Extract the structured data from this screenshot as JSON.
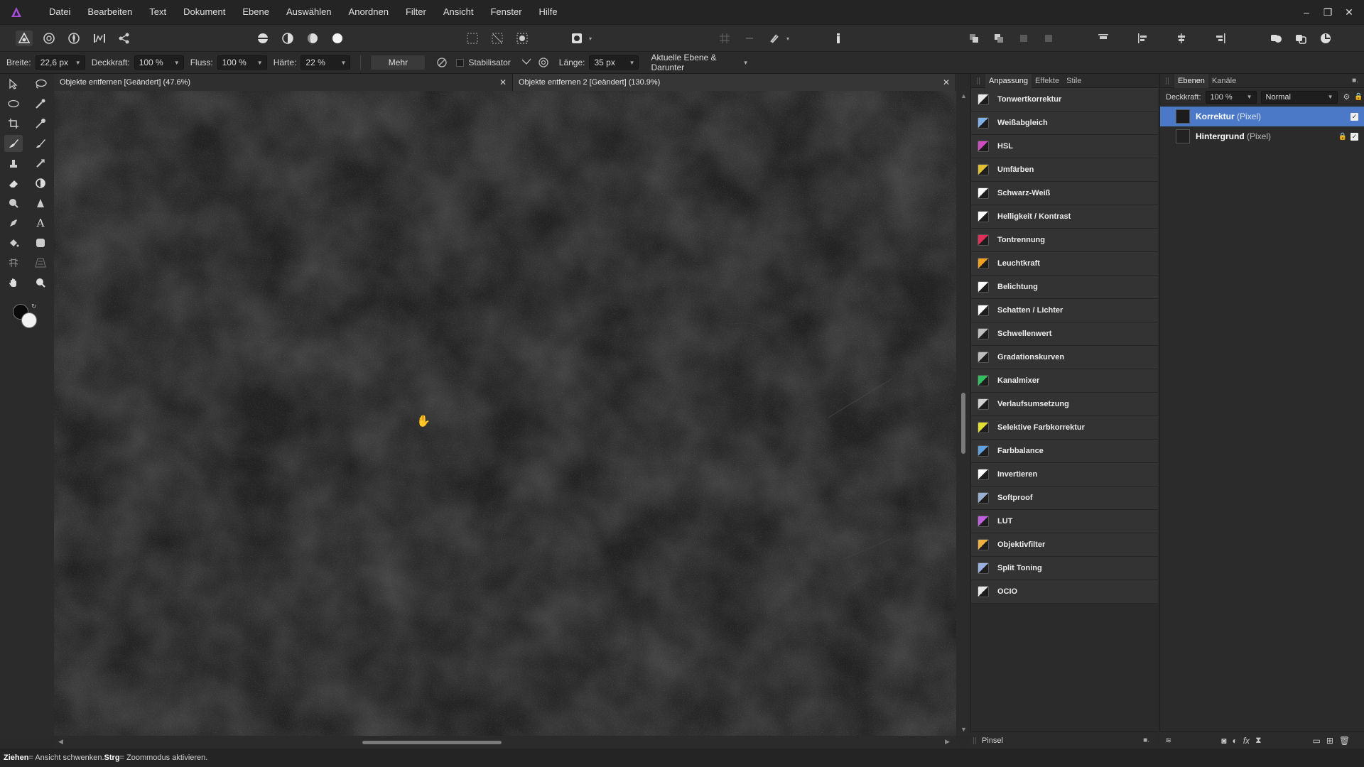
{
  "menubar": {
    "items": [
      "Datei",
      "Bearbeiten",
      "Text",
      "Dokument",
      "Ebene",
      "Auswählen",
      "Anordnen",
      "Filter",
      "Ansicht",
      "Fenster",
      "Hilfe"
    ],
    "window_controls": [
      "–",
      "❐",
      "✕"
    ]
  },
  "context_toolbar": {
    "width_label": "Breite:",
    "width_value": "22,6 px",
    "opacity_label": "Deckkraft:",
    "opacity_value": "100 %",
    "flow_label": "Fluss:",
    "flow_value": "100 %",
    "hardness_label": "Härte:",
    "hardness_value": "22 %",
    "more_label": "Mehr",
    "stabilizer_label": "Stabilisator",
    "length_label": "Länge:",
    "length_value": "35 px",
    "sample_label": "Aktuelle Ebene & Darunter"
  },
  "documents": {
    "tabs": [
      {
        "title": "Objekte entfernen [Geändert] (47.6%)",
        "close": "✕"
      },
      {
        "title": "Objekte entfernen 2 [Geändert] (130.9%)",
        "close": "✕"
      }
    ]
  },
  "adjustment_panel": {
    "tabs": [
      "Anpassung",
      "Effekte",
      "Stile"
    ],
    "items": [
      {
        "label": "Tonwertkorrektur",
        "icon": "levels-icon",
        "color": "#e8e8e8"
      },
      {
        "label": "Weißabgleich",
        "icon": "white-balance-icon",
        "color": "#7fb0e6"
      },
      {
        "label": "HSL",
        "icon": "hsl-icon",
        "color": "#d04ac0"
      },
      {
        "label": "Umfärben",
        "icon": "recolor-icon",
        "color": "#e0c030"
      },
      {
        "label": "Schwarz-Weiß",
        "icon": "black-white-icon",
        "color": "#ffffff"
      },
      {
        "label": "Helligkeit / Kontrast",
        "icon": "brightness-contrast-icon",
        "color": "#ffffff"
      },
      {
        "label": "Tontrennung",
        "icon": "posterize-icon",
        "color": "#e0305a"
      },
      {
        "label": "Leuchtkraft",
        "icon": "vibrance-icon",
        "color": "#f0a020"
      },
      {
        "label": "Belichtung",
        "icon": "exposure-icon",
        "color": "#ffffff"
      },
      {
        "label": "Schatten / Lichter",
        "icon": "shadows-highlights-icon",
        "color": "#ffffff"
      },
      {
        "label": "Schwellenwert",
        "icon": "threshold-icon",
        "color": "#bdbdbd"
      },
      {
        "label": "Gradationskurven",
        "icon": "curves-icon",
        "color": "#bdbdbd"
      },
      {
        "label": "Kanalmixer",
        "icon": "channel-mixer-icon",
        "color": "#30c060"
      },
      {
        "label": "Verlaufsumsetzung",
        "icon": "gradient-map-icon",
        "color": "#d0d0d0"
      },
      {
        "label": "Selektive Farbkorrektur",
        "icon": "selective-color-icon",
        "color": "#e0e030"
      },
      {
        "label": "Farbbalance",
        "icon": "color-balance-icon",
        "color": "#60a0e0"
      },
      {
        "label": "Invertieren",
        "icon": "invert-icon",
        "color": "#ffffff"
      },
      {
        "label": "Softproof",
        "icon": "soft-proof-icon",
        "color": "#9ab0d0"
      },
      {
        "label": "LUT",
        "icon": "lut-icon",
        "color": "#c060e0"
      },
      {
        "label": "Objektivfilter",
        "icon": "lens-filter-icon",
        "color": "#f0b040"
      },
      {
        "label": "Split Toning",
        "icon": "split-toning-icon",
        "color": "#9ab0e0"
      },
      {
        "label": "OCIO",
        "icon": "ocio-icon",
        "color": "#e8e8e8"
      }
    ],
    "footer_label": "Pinsel"
  },
  "layers_panel": {
    "tabs": [
      "Ebenen",
      "Kanäle"
    ],
    "opacity_label": "Deckkraft:",
    "opacity_value": "100 %",
    "blend_mode": "Normal",
    "layers": [
      {
        "name": "Korrektur",
        "type": "(Pixel)",
        "selected": true
      },
      {
        "name": "Hintergrund",
        "type": "(Pixel)",
        "selected": false
      }
    ]
  },
  "statusbar": {
    "key1": "Ziehen",
    "text1": " = Ansicht schwenken. ",
    "key2": "Strg",
    "text2": " = Zoommodus aktivieren."
  },
  "colors": {
    "accent": "#4c79c7",
    "app_logo": "#a54ed6"
  }
}
